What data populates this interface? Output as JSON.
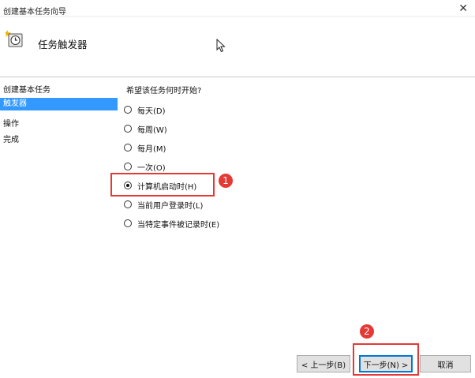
{
  "window": {
    "title": "创建基本任务向导",
    "close_label": "✕"
  },
  "header": {
    "title": "任务触发器",
    "icon": "scheduled-task-clock-icon"
  },
  "nav": {
    "items": [
      {
        "label": "创建基本任务",
        "selected": false
      },
      {
        "label": "触发器",
        "selected": true
      },
      {
        "label": "操作",
        "selected": false
      },
      {
        "label": "完成",
        "selected": false
      }
    ]
  },
  "main": {
    "question": "希望该任务何时开始?",
    "options": [
      {
        "label": "每天(D)",
        "checked": false
      },
      {
        "label": "每周(W)",
        "checked": false
      },
      {
        "label": "每月(M)",
        "checked": false
      },
      {
        "label": "一次(O)",
        "checked": false
      },
      {
        "label": "计算机启动时(H)",
        "checked": true
      },
      {
        "label": "当前用户登录时(L)",
        "checked": false
      },
      {
        "label": "当特定事件被记录时(E)",
        "checked": false
      }
    ]
  },
  "annotations": {
    "badge1": "1",
    "badge2": "2",
    "highlight_color": "#e53935"
  },
  "buttons": {
    "back": "< 上一步(B)",
    "next": "下一步(N) >",
    "cancel": "取消"
  },
  "colors": {
    "selection": "#3399ff",
    "focus": "#0078d7"
  }
}
